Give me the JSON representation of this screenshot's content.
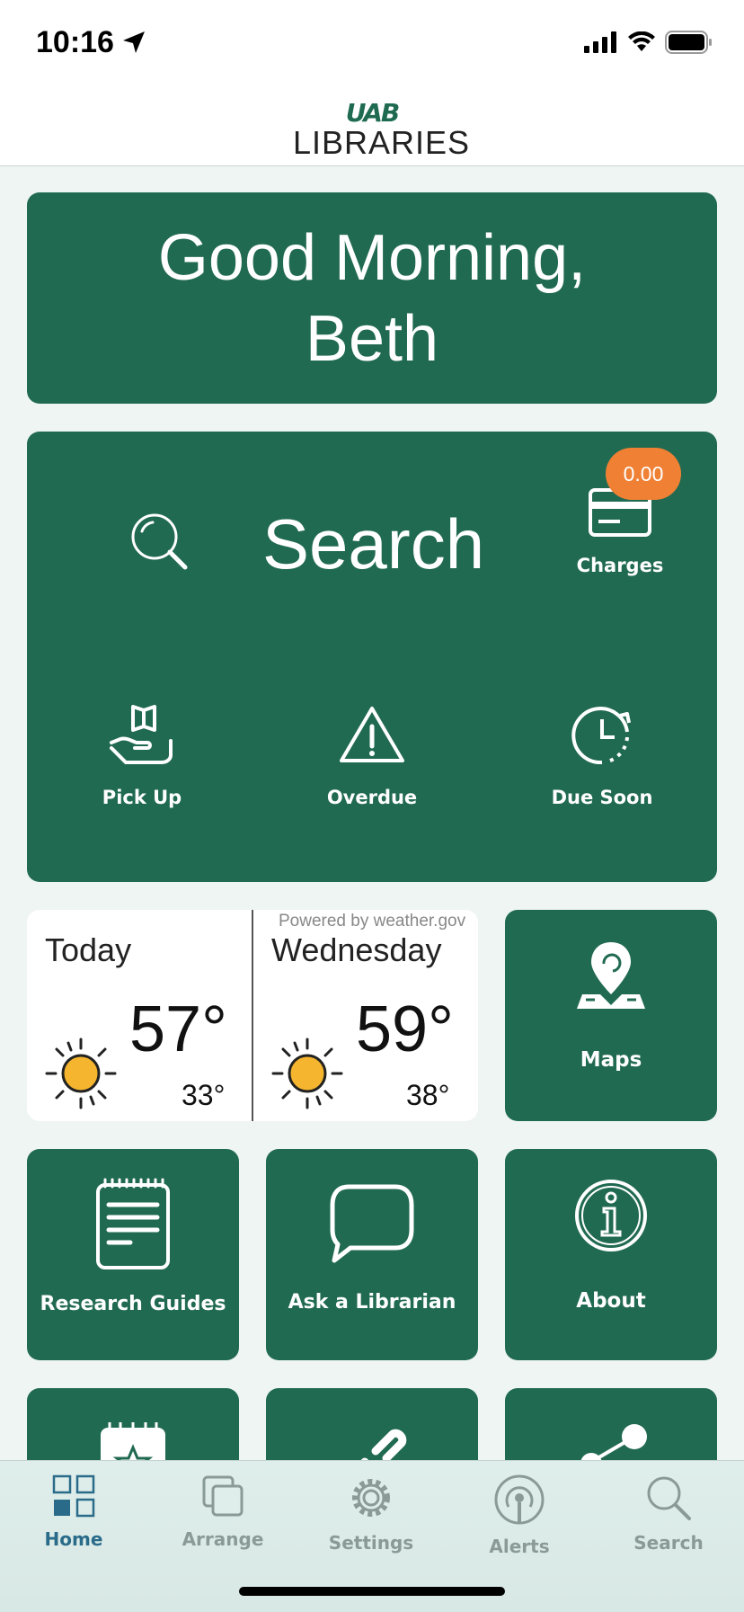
{
  "status_bar": {
    "time": "10:16"
  },
  "header": {
    "logo_top": "UAB",
    "logo_bottom": "LIBRARIES"
  },
  "greeting": {
    "line1": "Good Morning,",
    "line2": "Beth"
  },
  "quick_actions": {
    "search_label": "Search",
    "charges_label": "Charges",
    "charges_badge": "0.00",
    "pickup_label": "Pick Up",
    "overdue_label": "Overdue",
    "due_soon_label": "Due Soon"
  },
  "weather": {
    "powered_by": "Powered by weather.gov",
    "today": {
      "day": "Today",
      "high": "57°",
      "low": "33°",
      "icon": "sun-icon"
    },
    "next": {
      "day": "Wednesday",
      "high": "59°",
      "low": "38°",
      "icon": "sun-icon"
    }
  },
  "tiles": {
    "maps": "Maps",
    "research_guides": "Research Guides",
    "ask_librarian": "Ask a Librarian",
    "about": "About"
  },
  "tabbar": {
    "items": [
      {
        "label": "Home",
        "icon": "grid-icon",
        "active": true
      },
      {
        "label": "Arrange",
        "icon": "arrange-icon",
        "active": false
      },
      {
        "label": "Settings",
        "icon": "gear-icon",
        "active": false
      },
      {
        "label": "Alerts",
        "icon": "broadcast-icon",
        "active": false
      },
      {
        "label": "Search",
        "icon": "search-icon",
        "active": false
      }
    ]
  },
  "colors": {
    "brand_green": "#216a52",
    "badge_orange": "#f08034",
    "active_tab": "#2a6b8a",
    "sun_yellow": "#f5b52e"
  }
}
